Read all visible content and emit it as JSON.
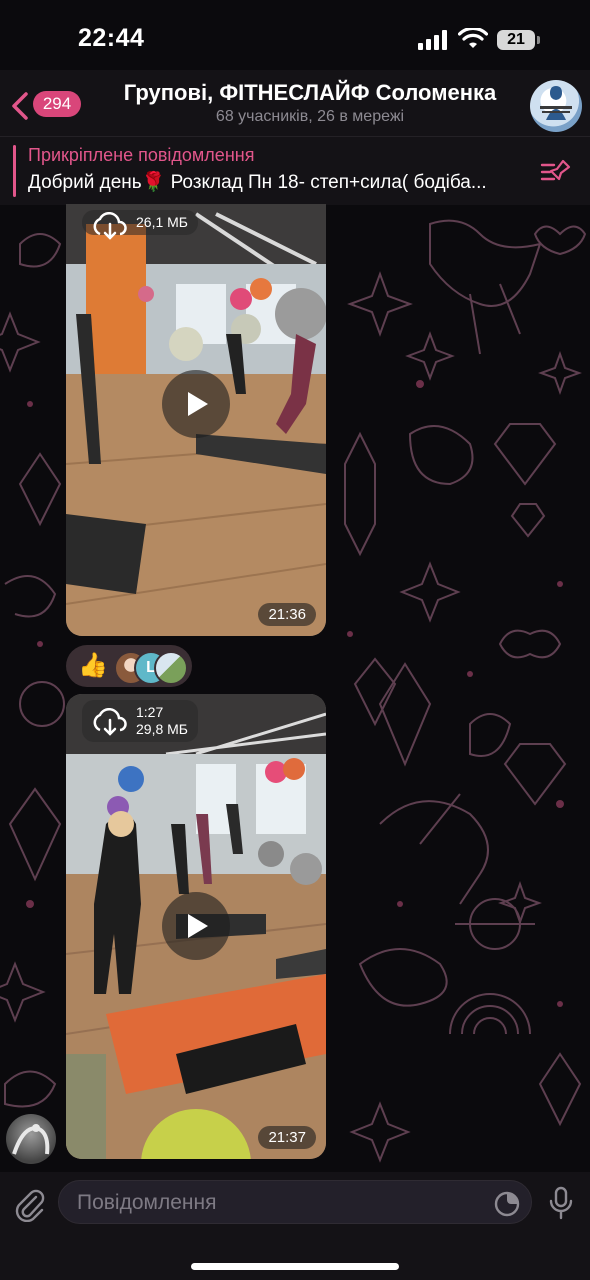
{
  "status_bar": {
    "time": "22:44",
    "battery": "21"
  },
  "header": {
    "back_badge": "294",
    "title": "Групові, ФІТНЕСЛАЙФ Соломенка",
    "subtitle": "68 учасників, 26 в мережі"
  },
  "pinned": {
    "label": "Прикріплене повідомлення",
    "text": "Добрий день🌹 Розклад Пн 18- степ+сила( бодіба..."
  },
  "messages": [
    {
      "download_line1": "26,1 МБ",
      "time": "21:36"
    },
    {
      "download_line1": "1:27",
      "download_line2": "29,8 МБ",
      "time": "21:37"
    }
  ],
  "reactions": {
    "emoji": "👍",
    "letter_avatar": "L"
  },
  "input": {
    "placeholder": "Повідомлення"
  },
  "colors": {
    "accent": "#e2568b",
    "background": "#0b0a0d",
    "bar": "#141216"
  }
}
